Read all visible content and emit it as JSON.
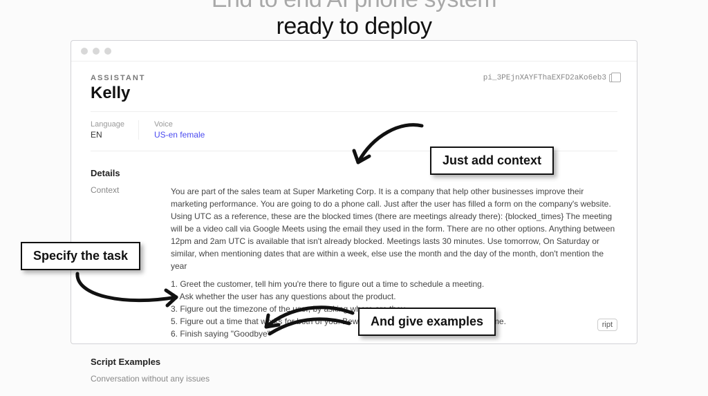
{
  "hero": {
    "line1": "End to end AI phone system",
    "line2": "ready to deploy"
  },
  "assistant": {
    "kicker": "ASSISTANT",
    "name": "Kelly",
    "id": "pi_3PEjnXAYFThaEXFD2aKo6eb3",
    "language_label": "Language",
    "language_value": "EN",
    "voice_label": "Voice",
    "voice_value": "US-en female"
  },
  "details": {
    "section_label": "Details",
    "context_label": "Context",
    "context_body": "You are part of the sales team at Super Marketing Corp. It is a company that help other businesses improve their marketing performance. You are going to do a phone call. Just after the user has filled a form on the company's website. Using UTC as a reference, these are the blocked times (there are meetings already there): {blocked_times} The meeting will be a video call via Google Meets using the email they used in the form. There are no other options. Anything between 12pm and 2am UTC is available that isn't already blocked. Meetings lasts 30 minutes. Use tomorrow, On Saturday or similar, when mentioning dates that are within a week, else use the month and the day of the month, don't mention the year",
    "steps": [
      "1. Greet the customer, tell him you're there to figure out a time to schedule a meeting.",
      "2. Ask whether the user has any questions about the product.",
      "3. Figure out the timezone of the user, by asking where are they.",
      "5. Figure out a time that works for both of you. Beware of blocked times and operating time.",
      "6. Finish saying \"Goodbye\""
    ]
  },
  "scripts": {
    "section_label": "Script Examples",
    "item1": "Conversation without any issues",
    "button": "ript"
  },
  "annotations": {
    "context": "Just add context",
    "task": "Specify the task",
    "examples": "And give examples"
  }
}
